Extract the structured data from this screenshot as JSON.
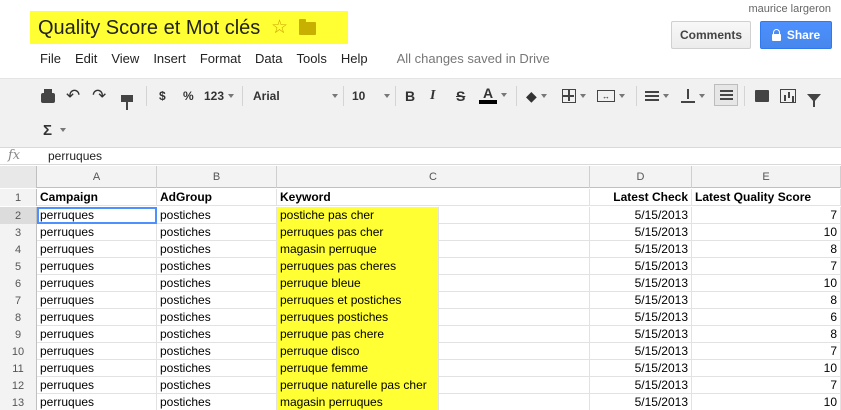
{
  "header": {
    "title": "Quality Score et Mot clés",
    "user": "maurice largeron",
    "comments_label": "Comments",
    "share_label": "Share",
    "colors": {
      "title_highlight": "#ffff33",
      "share_blue": "#4d90fe"
    }
  },
  "menu": {
    "items": [
      "File",
      "Edit",
      "View",
      "Insert",
      "Format",
      "Data",
      "Tools",
      "Help"
    ],
    "save_status": "All changes saved in Drive"
  },
  "toolbar": {
    "currency": "$",
    "percent": "%",
    "number_format": "123",
    "font": "Arial",
    "font_size": "10",
    "bold": "B",
    "italic": "I",
    "strike": "S",
    "text_color": "A",
    "functions": "Σ",
    "icons": [
      "printer-icon",
      "undo-icon",
      "redo-icon",
      "paint-format-icon",
      "fill-color-icon",
      "borders-icon",
      "merge-icon",
      "align-icon",
      "valign-icon",
      "wrap-icon",
      "comment-icon",
      "chart-icon",
      "filter-icon"
    ]
  },
  "formula_bar": {
    "label": "fx",
    "value": "perruques"
  },
  "grid": {
    "columns": [
      "A",
      "B",
      "C",
      "D",
      "E"
    ],
    "header": {
      "row": "1",
      "cells": [
        "Campaign",
        "AdGroup",
        "Keyword",
        "Latest Check",
        "Latest Quality Score"
      ]
    },
    "rows": [
      {
        "num": "2",
        "campaign": "perruques",
        "adgroup": "postiches",
        "keyword": "postiche pas cher",
        "check": "5/15/2013",
        "score": "7"
      },
      {
        "num": "3",
        "campaign": "perruques",
        "adgroup": "postiches",
        "keyword": "perruques pas cher",
        "check": "5/15/2013",
        "score": "10"
      },
      {
        "num": "4",
        "campaign": "perruques",
        "adgroup": "postiches",
        "keyword": "magasin perruque",
        "check": "5/15/2013",
        "score": "8"
      },
      {
        "num": "5",
        "campaign": "perruques",
        "adgroup": "postiches",
        "keyword": "perruques pas cheres",
        "check": "5/15/2013",
        "score": "7"
      },
      {
        "num": "6",
        "campaign": "perruques",
        "adgroup": "postiches",
        "keyword": "perruque bleue",
        "check": "5/15/2013",
        "score": "10"
      },
      {
        "num": "7",
        "campaign": "perruques",
        "adgroup": "postiches",
        "keyword": "perruques et postiches",
        "check": "5/15/2013",
        "score": "8"
      },
      {
        "num": "8",
        "campaign": "perruques",
        "adgroup": "postiches",
        "keyword": "perruques postiches",
        "check": "5/15/2013",
        "score": "6"
      },
      {
        "num": "9",
        "campaign": "perruques",
        "adgroup": "postiches",
        "keyword": "perruque pas chere",
        "check": "5/15/2013",
        "score": "8"
      },
      {
        "num": "10",
        "campaign": "perruques",
        "adgroup": "postiches",
        "keyword": "perruque disco",
        "check": "5/15/2013",
        "score": "7"
      },
      {
        "num": "11",
        "campaign": "perruques",
        "adgroup": "postiches",
        "keyword": "perruque femme",
        "check": "5/15/2013",
        "score": "10"
      },
      {
        "num": "12",
        "campaign": "perruques",
        "adgroup": "postiches",
        "keyword": "perruque naturelle pas cher",
        "check": "5/15/2013",
        "score": "7"
      },
      {
        "num": "13",
        "campaign": "perruques",
        "adgroup": "postiches",
        "keyword": "magasin perruques",
        "check": "5/15/2013",
        "score": "10"
      }
    ]
  }
}
